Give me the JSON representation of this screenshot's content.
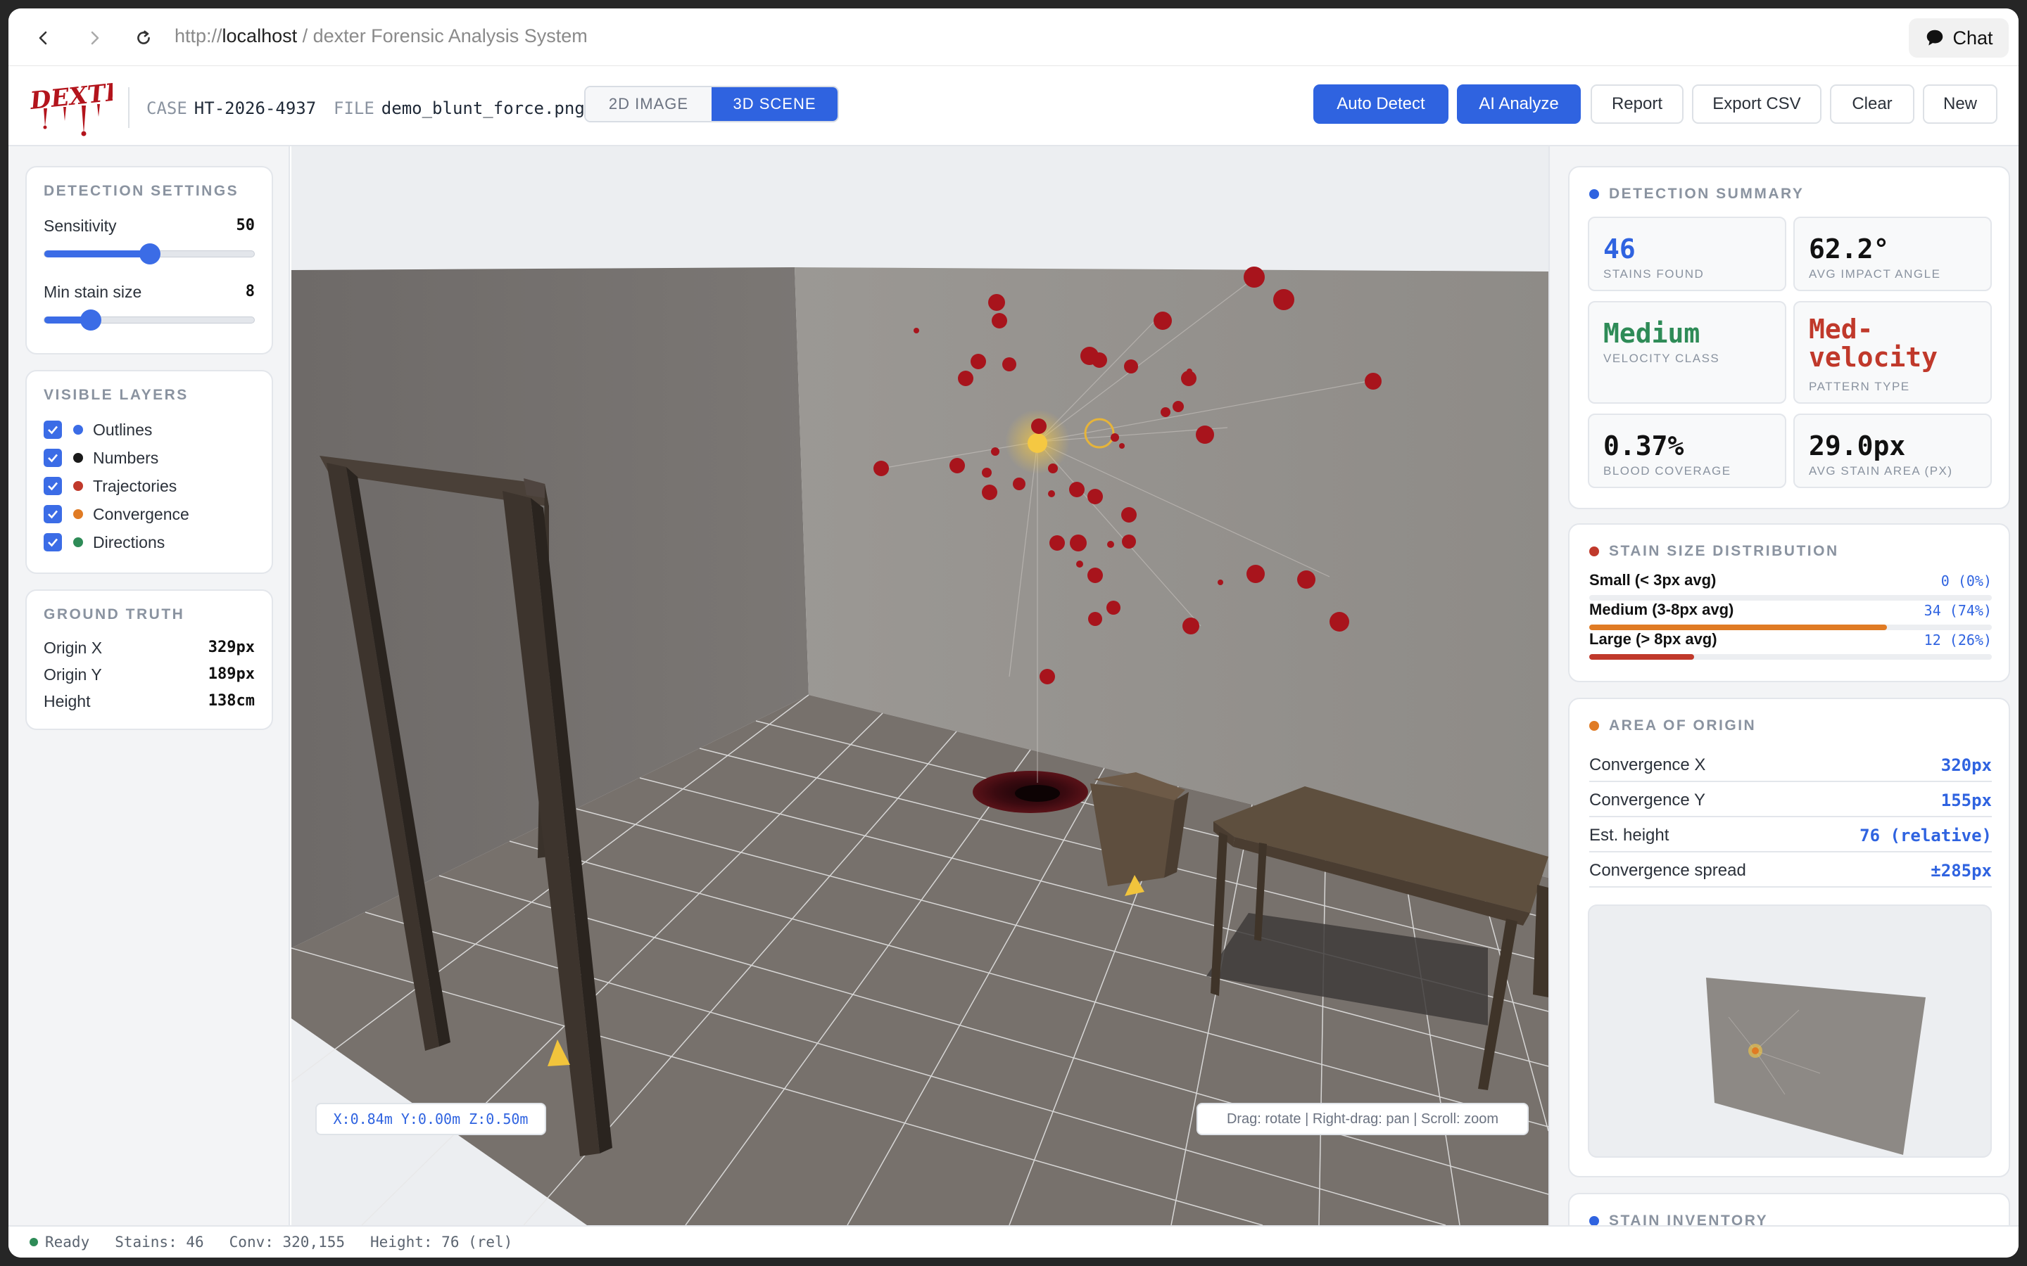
{
  "browser": {
    "url_scheme": "http://",
    "url_host": "localhost",
    "url_sep": " / ",
    "page_title": "dexter Forensic Analysis System",
    "chat_label": "Chat"
  },
  "header": {
    "logo_text": "DEXTER",
    "case_label": "CASE",
    "case_value": "HT-2026-4937",
    "file_label": "FILE",
    "file_value": "demo_blunt_force.png",
    "view_tabs": [
      "2D IMAGE",
      "3D SCENE"
    ],
    "active_view": "3D SCENE",
    "buttons": {
      "auto_detect": "Auto Detect",
      "ai_analyze": "AI Analyze",
      "report": "Report",
      "export_csv": "Export CSV",
      "clear": "Clear",
      "new": "New"
    },
    "accent": "#2f63e0"
  },
  "detection_settings": {
    "title": "DETECTION SETTINGS",
    "sensitivity": {
      "label": "Sensitivity",
      "value": "50",
      "fraction": 0.5
    },
    "min_stain": {
      "label": "Min stain size",
      "value": "8",
      "fraction": 0.22
    }
  },
  "visible_layers": {
    "title": "VISIBLE LAYERS",
    "items": [
      {
        "label": "Outlines",
        "color": "#3b6ce6",
        "checked": true
      },
      {
        "label": "Numbers",
        "color": "#1a1a1a",
        "checked": true
      },
      {
        "label": "Trajectories",
        "color": "#c0392b",
        "checked": true
      },
      {
        "label": "Convergence",
        "color": "#e07b24",
        "checked": true
      },
      {
        "label": "Directions",
        "color": "#2e8b57",
        "checked": true
      }
    ]
  },
  "ground_truth": {
    "title": "GROUND TRUTH",
    "rows": [
      {
        "label": "Origin X",
        "value": "329px"
      },
      {
        "label": "Origin Y",
        "value": "189px"
      },
      {
        "label": "Height",
        "value": "138cm"
      }
    ]
  },
  "viewport": {
    "coords": "X:0.84m Y:0.00m Z:0.50m",
    "help": "Drag: rotate | Right-drag: pan | Scroll: zoom"
  },
  "detection_summary": {
    "title": "DETECTION SUMMARY",
    "stats": [
      {
        "value": "46",
        "caption": "STAINS FOUND",
        "color": "#2f63e0"
      },
      {
        "value": "62.2°",
        "caption": "AVG IMPACT ANGLE",
        "color": "#111111"
      },
      {
        "value": "Medium",
        "caption": "VELOCITY CLASS",
        "color": "#2e8b57"
      },
      {
        "value": "Med-velocity",
        "caption": "PATTERN TYPE",
        "color": "#c0392b"
      },
      {
        "value": "0.37%",
        "caption": "BLOOD COVERAGE",
        "color": "#111111"
      },
      {
        "value": "29.0px",
        "caption": "AVG STAIN AREA (PX)",
        "color": "#111111"
      }
    ]
  },
  "stain_distribution": {
    "title": "STAIN SIZE DISTRIBUTION",
    "rows": [
      {
        "label": "Small (< 3px avg)",
        "count": "0 (0%)",
        "fraction": 0.0,
        "color": "#2f63e0"
      },
      {
        "label": "Medium (3-8px avg)",
        "count": "34 (74%)",
        "fraction": 0.74,
        "color": "#e07b24"
      },
      {
        "label": "Large (> 8px avg)",
        "count": "12 (26%)",
        "fraction": 0.26,
        "color": "#c0392b"
      }
    ]
  },
  "area_of_origin": {
    "title": "AREA OF ORIGIN",
    "rows": [
      {
        "label": "Convergence X",
        "value": "320px"
      },
      {
        "label": "Convergence Y",
        "value": "155px"
      },
      {
        "label": "Est. height",
        "value": "76 (relative)"
      },
      {
        "label": "Convergence spread",
        "value": "±285px"
      }
    ]
  },
  "stain_inventory": {
    "title": "STAIN INVENTORY"
  },
  "status_bar": {
    "ready": "Ready",
    "stains": "Stains: 46",
    "conv": "Conv: 320,155",
    "height": "Height: 76 (rel)"
  }
}
